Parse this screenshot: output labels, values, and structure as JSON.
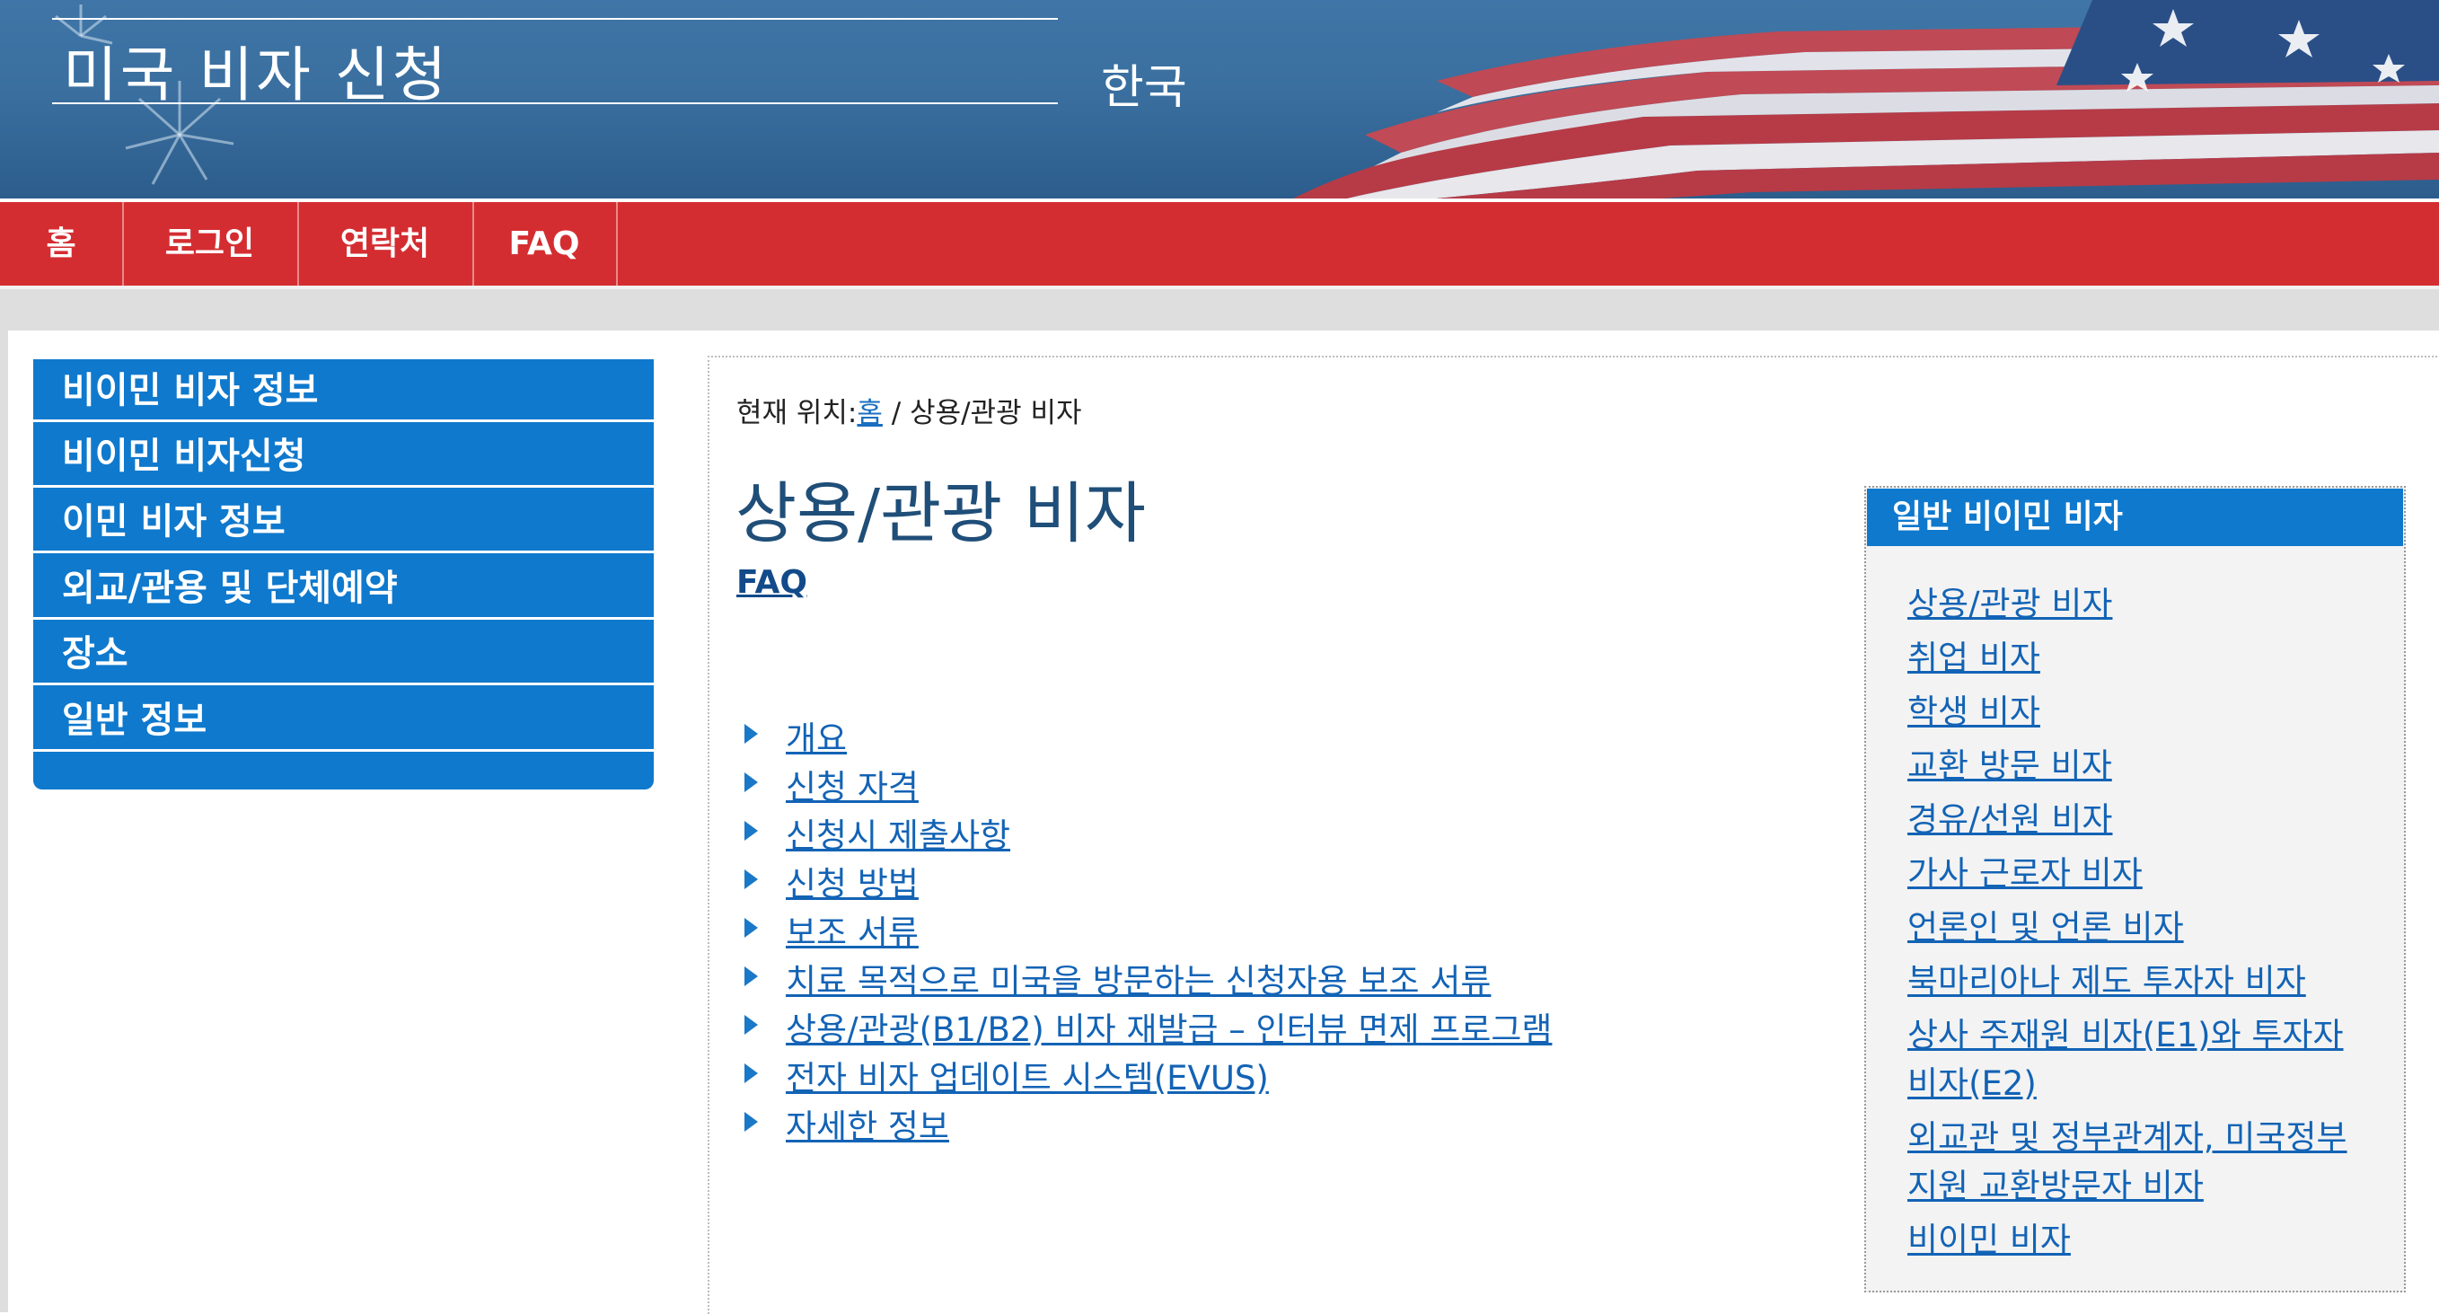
{
  "header": {
    "site_title": "미국 비자 신청",
    "country": "한국"
  },
  "topnav": {
    "items": [
      {
        "label": "홈"
      },
      {
        "label": "로그인"
      },
      {
        "label": "연락처"
      },
      {
        "label": "FAQ"
      }
    ]
  },
  "sidebar": {
    "items": [
      {
        "label": "비이민 비자 정보"
      },
      {
        "label": "비이민 비자신청"
      },
      {
        "label": "이민 비자 정보"
      },
      {
        "label": "외교/관용 및 단체예약"
      },
      {
        "label": "장소"
      },
      {
        "label": "일반 정보"
      }
    ]
  },
  "breadcrumb": {
    "prefix": "현재 위치:",
    "home": "홈",
    "separator": " / ",
    "current": "상용/관광 비자"
  },
  "main": {
    "title": "상용/관광 비자",
    "faq_label": "FAQ",
    "topics": [
      {
        "label": "개요"
      },
      {
        "label": "신청 자격"
      },
      {
        "label": "신청시 제출사항"
      },
      {
        "label": "신청 방법"
      },
      {
        "label": "보조 서류"
      },
      {
        "label": "치료 목적으로 미국을 방문하는 신청자용 보조 서류"
      },
      {
        "label": "상용/관광(B1/B2) 비자 재발급 – 인터뷰 면제 프로그램"
      },
      {
        "label": "전자 비자 업데이트 시스템(EVUS)"
      },
      {
        "label": "자세한 정보"
      }
    ]
  },
  "right_box": {
    "header": "일반 비이민 비자",
    "links": [
      {
        "lines": [
          "상용/관광 비자"
        ]
      },
      {
        "lines": [
          "취업 비자"
        ]
      },
      {
        "lines": [
          "학생 비자"
        ]
      },
      {
        "lines": [
          "교환 방문 비자"
        ]
      },
      {
        "lines": [
          "경유/선원 비자"
        ]
      },
      {
        "lines": [
          "가사 근로자 비자"
        ]
      },
      {
        "lines": [
          "언론인 및 언론 비자"
        ]
      },
      {
        "lines": [
          "북마리아나 제도 투자자 비자"
        ]
      },
      {
        "lines": [
          "상사 주재원 비자(E1)와 투자자",
          "비자(E2)"
        ]
      },
      {
        "lines": [
          "외교관 및 정부관계자, 미국정부",
          "지원 교환방문자 비자"
        ]
      },
      {
        "lines": [
          "비이민 비자"
        ]
      }
    ]
  },
  "colors": {
    "nav_red": "#d42d31",
    "sidebar_blue": "#0f79cd",
    "link_blue": "#1363b5",
    "title_navy": "#1f4e78"
  }
}
